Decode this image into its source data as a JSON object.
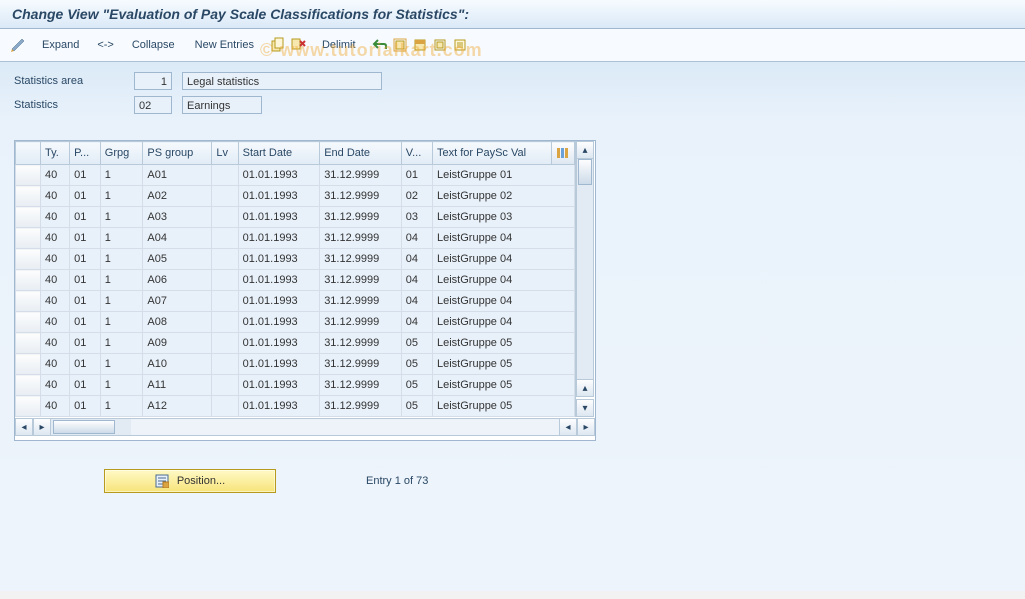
{
  "title": "Change View \"Evaluation of Pay Scale Classifications for Statistics\":",
  "toolbar": {
    "expand": "Expand",
    "sep": "<->",
    "collapse": "Collapse",
    "new_entries": "New Entries",
    "delimit": "Delimit"
  },
  "fields": {
    "stat_area_label": "Statistics area",
    "stat_area_value": "1",
    "stat_area_text": "Legal statistics",
    "statistics_label": "Statistics",
    "statistics_value": "02",
    "statistics_text": "Earnings"
  },
  "columns": [
    "Ty.",
    "P...",
    "Grpg",
    "PS group",
    "Lv",
    "Start Date",
    "End Date",
    "V...",
    "Text for PaySc Val"
  ],
  "rows": [
    {
      "ty": "40",
      "p": "01",
      "grpg": "1",
      "psg": "A01",
      "lv": "",
      "start": "01.01.1993",
      "end": "31.12.9999",
      "v": "01",
      "text": "LeistGruppe 01"
    },
    {
      "ty": "40",
      "p": "01",
      "grpg": "1",
      "psg": "A02",
      "lv": "",
      "start": "01.01.1993",
      "end": "31.12.9999",
      "v": "02",
      "text": "LeistGruppe 02"
    },
    {
      "ty": "40",
      "p": "01",
      "grpg": "1",
      "psg": "A03",
      "lv": "",
      "start": "01.01.1993",
      "end": "31.12.9999",
      "v": "03",
      "text": "LeistGruppe 03"
    },
    {
      "ty": "40",
      "p": "01",
      "grpg": "1",
      "psg": "A04",
      "lv": "",
      "start": "01.01.1993",
      "end": "31.12.9999",
      "v": "04",
      "text": "LeistGruppe 04"
    },
    {
      "ty": "40",
      "p": "01",
      "grpg": "1",
      "psg": "A05",
      "lv": "",
      "start": "01.01.1993",
      "end": "31.12.9999",
      "v": "04",
      "text": "LeistGruppe 04"
    },
    {
      "ty": "40",
      "p": "01",
      "grpg": "1",
      "psg": "A06",
      "lv": "",
      "start": "01.01.1993",
      "end": "31.12.9999",
      "v": "04",
      "text": "LeistGruppe 04"
    },
    {
      "ty": "40",
      "p": "01",
      "grpg": "1",
      "psg": "A07",
      "lv": "",
      "start": "01.01.1993",
      "end": "31.12.9999",
      "v": "04",
      "text": "LeistGruppe 04"
    },
    {
      "ty": "40",
      "p": "01",
      "grpg": "1",
      "psg": "A08",
      "lv": "",
      "start": "01.01.1993",
      "end": "31.12.9999",
      "v": "04",
      "text": "LeistGruppe 04"
    },
    {
      "ty": "40",
      "p": "01",
      "grpg": "1",
      "psg": "A09",
      "lv": "",
      "start": "01.01.1993",
      "end": "31.12.9999",
      "v": "05",
      "text": "LeistGruppe 05"
    },
    {
      "ty": "40",
      "p": "01",
      "grpg": "1",
      "psg": "A10",
      "lv": "",
      "start": "01.01.1993",
      "end": "31.12.9999",
      "v": "05",
      "text": "LeistGruppe 05"
    },
    {
      "ty": "40",
      "p": "01",
      "grpg": "1",
      "psg": "A11",
      "lv": "",
      "start": "01.01.1993",
      "end": "31.12.9999",
      "v": "05",
      "text": "LeistGruppe 05"
    },
    {
      "ty": "40",
      "p": "01",
      "grpg": "1",
      "psg": "A12",
      "lv": "",
      "start": "01.01.1993",
      "end": "31.12.9999",
      "v": "05",
      "text": "LeistGruppe 05"
    }
  ],
  "position_button": "Position...",
  "entry_status": "Entry 1 of 73",
  "watermark": "© www.tutorialkart.com"
}
